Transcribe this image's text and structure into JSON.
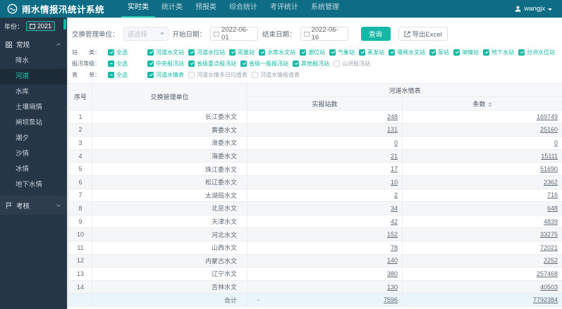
{
  "app": {
    "title": "雨水情报汛统计系统",
    "nav_items": [
      "实时类",
      "统计类",
      "预报类",
      "综合统计",
      "考评统计",
      "系统管理"
    ],
    "active_nav_index": 0,
    "username": "wangjx"
  },
  "sidebar": {
    "year_label": "年份：",
    "year_value": "2021",
    "group_main_label": "常规",
    "menu_items": [
      "降水",
      "河道",
      "水库",
      "土壤墒情",
      "闸坝泵站",
      "潮夕",
      "沙情",
      "冰情",
      "地下水情"
    ],
    "active_item": "河道",
    "group_bottom_label": "考核"
  },
  "filters": {
    "unit_label": "交换管理单位：",
    "unit_placeholder": "请选择",
    "start_date_label": "开始日期：",
    "start_date_value": "2022-06-01",
    "end_date_label": "结束日期：",
    "end_date_value": "2022-06-16",
    "query_button": "查询",
    "export_button": "导出Excel"
  },
  "checkbox_groups": [
    {
      "label": "站　　类：",
      "options": [
        {
          "text": "全选",
          "state": "checked"
        },
        {
          "text": "河道水文站",
          "state": "checked"
        },
        {
          "text": "河道水位站",
          "state": "checked"
        },
        {
          "text": "雨量站",
          "state": "checked"
        },
        {
          "text": "水库水文站",
          "state": "checked"
        },
        {
          "text": "潮位站",
          "state": "checked"
        },
        {
          "text": "气象站",
          "state": "checked"
        },
        {
          "text": "蒸发站",
          "state": "checked"
        },
        {
          "text": "堰闸水文站",
          "state": "checked"
        },
        {
          "text": "泵站",
          "state": "checked"
        },
        {
          "text": "墒情站",
          "state": "checked"
        },
        {
          "text": "地下水站",
          "state": "checked"
        },
        {
          "text": "分洪水位站",
          "state": "checked"
        }
      ]
    },
    {
      "label": "报汛等级：",
      "options": [
        {
          "text": "全选",
          "state": "indeterminate"
        },
        {
          "text": "中央报汛站",
          "state": "checked"
        },
        {
          "text": "省级重点报汛站",
          "state": "checked"
        },
        {
          "text": "省级一般报汛站",
          "state": "checked"
        },
        {
          "text": "其他报汛站",
          "state": "checked"
        },
        {
          "text": "山洪报汛站",
          "state": "unchecked"
        }
      ]
    },
    {
      "label": "表　　单：",
      "options": [
        {
          "text": "全选",
          "state": "indeterminate"
        },
        {
          "text": "河道水情表",
          "state": "checked"
        },
        {
          "text": "河道水情多日均值表",
          "state": "unchecked"
        },
        {
          "text": "河道水情极值表",
          "state": "unchecked"
        }
      ]
    }
  ],
  "table": {
    "col_index": "序号",
    "col_unit": "交换管理单位",
    "group_header": "河道水情表",
    "col_stations": "实报站数",
    "col_records": "条数",
    "rows": [
      {
        "index": "1",
        "unit": "长江委水文",
        "stations": "248",
        "records": "169749"
      },
      {
        "index": "2",
        "unit": "黄委水文",
        "stations": "131",
        "records": "25160"
      },
      {
        "index": "3",
        "unit": "淮委水文",
        "stations": "0",
        "records": "0"
      },
      {
        "index": "4",
        "unit": "海委水文",
        "stations": "21",
        "records": "15111"
      },
      {
        "index": "5",
        "unit": "珠江委水文",
        "stations": "17",
        "records": "51690"
      },
      {
        "index": "6",
        "unit": "松辽委水文",
        "stations": "10",
        "records": "2362"
      },
      {
        "index": "7",
        "unit": "太湖局水文",
        "stations": "2",
        "records": "716"
      },
      {
        "index": "8",
        "unit": "北京水文",
        "stations": "34",
        "records": "648"
      },
      {
        "index": "9",
        "unit": "天津水文",
        "stations": "42",
        "records": "4839"
      },
      {
        "index": "10",
        "unit": "河北水文",
        "stations": "152",
        "records": "33275"
      },
      {
        "index": "11",
        "unit": "山西水文",
        "stations": "78",
        "records": "72021"
      },
      {
        "index": "12",
        "unit": "内蒙古水文",
        "stations": "140",
        "records": "2252"
      },
      {
        "index": "13",
        "unit": "辽宁水文",
        "stations": "380",
        "records": "257468"
      },
      {
        "index": "14",
        "unit": "吉林水文",
        "stations": "130",
        "records": "40503"
      }
    ],
    "summary": {
      "label": "合计",
      "placeholder": "-",
      "stations": "7596",
      "records": "7792384"
    }
  },
  "icons": {
    "logo": "wave-circle",
    "user": "person-silhouette",
    "year": "calendar",
    "group_main": "grid",
    "group_bottom": "flag",
    "date": "calendar",
    "export": "export-arrow",
    "sort": "caret-up-down"
  },
  "colors": {
    "accent": "#15b8a6",
    "topbar": "#0e6c84",
    "sidebar": "#253646",
    "summary_row": "#e9f5fb"
  }
}
